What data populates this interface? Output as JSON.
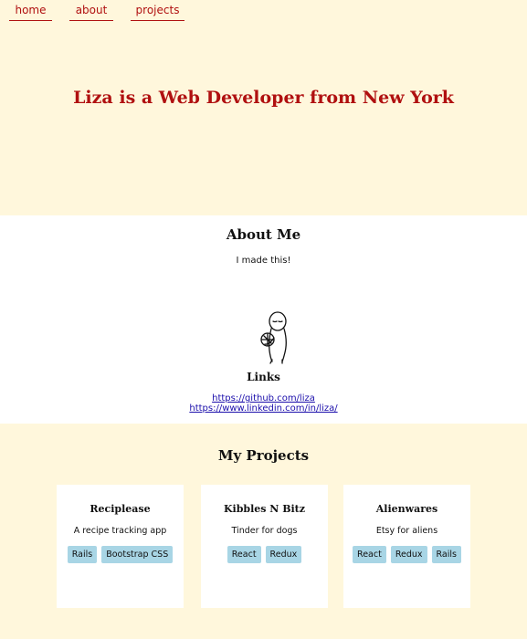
{
  "nav": {
    "items": [
      {
        "label": "home"
      },
      {
        "label": "about"
      },
      {
        "label": "projects"
      }
    ]
  },
  "hero": {
    "title": "Liza is a Web Developer from New York"
  },
  "about": {
    "heading": "About Me",
    "bio": "I made this!",
    "doodle_icon": "stick-figure-holding-ball-icon",
    "links_heading": "Links",
    "links": [
      {
        "text": "https://github.com/liza"
      },
      {
        "text": "https://www.linkedin.com/in/liza/"
      }
    ]
  },
  "projects": {
    "heading": "My Projects",
    "cards": [
      {
        "name": "Reciplease",
        "description": "A recipe tracking app",
        "tags": [
          "Rails",
          "Bootstrap CSS"
        ]
      },
      {
        "name": "Kibbles N Bitz",
        "description": "Tinder for dogs",
        "tags": [
          "React",
          "Redux"
        ]
      },
      {
        "name": "Alienwares",
        "description": "Etsy for aliens",
        "tags": [
          "React",
          "Redux",
          "Rails"
        ]
      }
    ]
  },
  "colors": {
    "accent": "#b01010",
    "cream": "#fff7dc",
    "tag": "#a8d5e5",
    "link": "#1a0dab"
  }
}
